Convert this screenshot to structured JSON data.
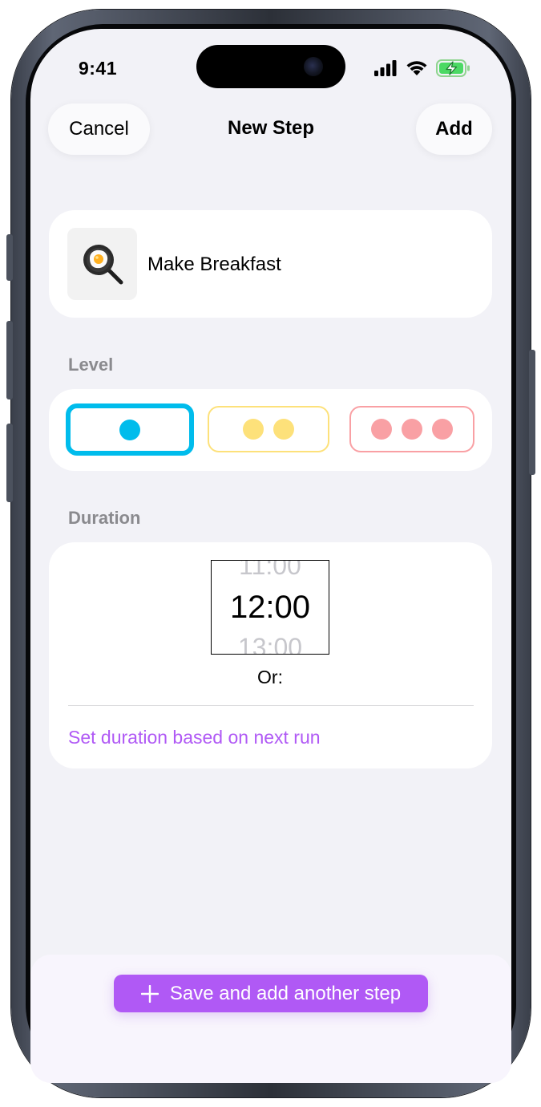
{
  "status_bar": {
    "time": "9:41",
    "icons": [
      "signal-icon",
      "wifi-icon",
      "battery-charging-icon"
    ]
  },
  "nav": {
    "cancel_label": "Cancel",
    "title": "New Step",
    "add_label": "Add"
  },
  "step": {
    "emoji": "🍳",
    "name": "Make Breakfast"
  },
  "level": {
    "label": "Level",
    "options": [
      {
        "dots": 1,
        "color": "#00bcec",
        "selected": true
      },
      {
        "dots": 2,
        "color": "#fde17a",
        "selected": false
      },
      {
        "dots": 3,
        "color": "#f9a0a4",
        "selected": false
      }
    ]
  },
  "duration": {
    "label": "Duration",
    "picker": {
      "prev": "11:00",
      "current": "12:00",
      "next": "13:00"
    },
    "or_label": "Or:",
    "based_on_next_run_label": "Set duration based on next run"
  },
  "footer": {
    "save_add_label": "Save and add another step"
  },
  "colors": {
    "accent": "#b059f5",
    "selected_level": "#00bcec",
    "background": "#f2f2f7"
  }
}
